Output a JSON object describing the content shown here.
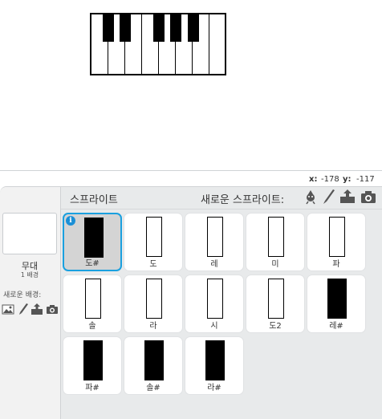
{
  "coords": {
    "x_label": "x:",
    "x_value": "-178",
    "y_label": "y:",
    "y_value": "-117"
  },
  "stage_panel": {
    "name": "무대",
    "backdrop_count": "1 배경",
    "new_backdrop_label": "새로운 배경:"
  },
  "sprites_panel": {
    "title": "스프라이트",
    "new_sprite_label": "새로운 스프라이트:"
  },
  "sprites": [
    {
      "name": "도#",
      "costume": "black",
      "selected": true
    },
    {
      "name": "도",
      "costume": "white",
      "selected": false
    },
    {
      "name": "레",
      "costume": "white",
      "selected": false
    },
    {
      "name": "미",
      "costume": "white",
      "selected": false
    },
    {
      "name": "파",
      "costume": "white",
      "selected": false
    },
    {
      "name": "솔",
      "costume": "white",
      "selected": false
    },
    {
      "name": "라",
      "costume": "white",
      "selected": false
    },
    {
      "name": "시",
      "costume": "white",
      "selected": false
    },
    {
      "name": "도2",
      "costume": "white",
      "selected": false
    },
    {
      "name": "레#",
      "costume": "black",
      "selected": false
    },
    {
      "name": "파#",
      "costume": "black",
      "selected": false
    },
    {
      "name": "솔#",
      "costume": "black",
      "selected": false
    },
    {
      "name": "라#",
      "costume": "black",
      "selected": false
    }
  ],
  "icons": {
    "backdrop_tools": [
      "image-library-icon",
      "paint-brush-icon",
      "upload-icon",
      "camera-icon"
    ],
    "sprite_tools": [
      "sprite-library-icon",
      "paint-brush-icon",
      "upload-icon",
      "camera-icon"
    ]
  },
  "colors": {
    "selection": "#1aa0df",
    "info_badge": "#1a8fd6",
    "pane_bg": "#e8eaeb"
  }
}
